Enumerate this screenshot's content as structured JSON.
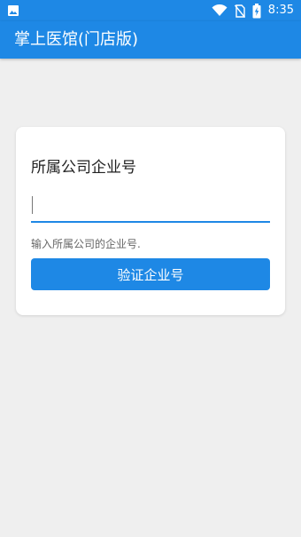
{
  "status_bar": {
    "time": "8:35",
    "icons": [
      "image-icon",
      "wifi-icon",
      "no-sim-icon",
      "battery-charging-icon"
    ]
  },
  "app_bar": {
    "title": "掌上医馆(门店版)"
  },
  "card": {
    "title": "所属公司企业号",
    "input": {
      "value": "",
      "placeholder": ""
    },
    "hint": "输入所属公司的企业号.",
    "button_label": "验证企业号"
  },
  "colors": {
    "primary": "#1e88e5",
    "background": "#efefef",
    "card": "#ffffff"
  }
}
